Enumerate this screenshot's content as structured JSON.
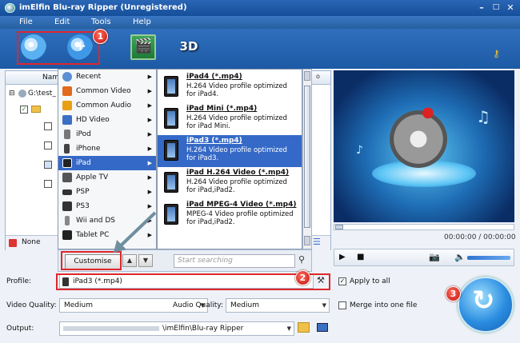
{
  "window": {
    "title": "imElfin Blu-ray Ripper (Unregistered)"
  },
  "menubar": {
    "items": [
      "File",
      "Edit",
      "Tools",
      "Help"
    ]
  },
  "filelist": {
    "header_name": "Name",
    "path": "G:\\test_",
    "subtitle_value": "None"
  },
  "categories": [
    {
      "label": "Recent",
      "icon": "clock-icon",
      "color": "#5b8fd6"
    },
    {
      "label": "Common Video",
      "icon": "film-icon",
      "color": "#e06a1e"
    },
    {
      "label": "Common Audio",
      "icon": "audio-icon",
      "color": "#e8a012"
    },
    {
      "label": "HD Video",
      "icon": "hd-icon",
      "color": "#3a6fc4"
    },
    {
      "label": "iPod",
      "icon": "ipod-icon",
      "color": "#777777"
    },
    {
      "label": "iPhone",
      "icon": "iphone-icon",
      "color": "#444444"
    },
    {
      "label": "iPad",
      "icon": "ipad-icon",
      "color": "#333333"
    },
    {
      "label": "Apple TV",
      "icon": "appletv-icon",
      "color": "#555555"
    },
    {
      "label": "PSP",
      "icon": "psp-icon",
      "color": "#333333"
    },
    {
      "label": "PS3",
      "icon": "ps3-icon",
      "color": "#333333"
    },
    {
      "label": "Wii and DS",
      "icon": "wii-icon",
      "color": "#888888"
    },
    {
      "label": "Tablet PC",
      "icon": "tablet-icon",
      "color": "#222222"
    }
  ],
  "selected_category": "iPad",
  "profiles": [
    {
      "title": "iPad4 (*.mp4)",
      "desc": "H.264 Video profile optimized for iPad4."
    },
    {
      "title": "iPad Mini (*.mp4)",
      "desc": "H.264 Video profile optimized for iPad Mini."
    },
    {
      "title": "iPad3 (*.mp4)",
      "desc": "H.264 Video profile optimized for iPad3."
    },
    {
      "title": "iPad H.264 Video (*.mp4)",
      "desc": "H.264 Video profile optimized for iPad,iPad2."
    },
    {
      "title": "iPad MPEG-4 Video (*.mp4)",
      "desc": "MPEG-4 Video profile optimized for iPad,iPad2."
    }
  ],
  "selected_profile": "iPad3 (*.mp4)",
  "bottom": {
    "customise_label": "Customise",
    "search_placeholder": "Start searching"
  },
  "player": {
    "time": "00:00:00 / 00:00:00"
  },
  "settings": {
    "profile_label": "Profile:",
    "profile_value": "iPad3 (*.mp4)",
    "apply_all_label": "Apply to all",
    "video_quality_label": "Video Quality:",
    "video_quality_value": "Medium",
    "audio_quality_label": "Audio Quality:",
    "audio_quality_value": "Medium",
    "merge_label": "Merge into one file",
    "output_label": "Output:",
    "output_value": "\\imElfin\\Blu-ray Ripper"
  },
  "callouts": [
    "1",
    "2",
    "3"
  ],
  "colors": {
    "accent": "#3569c7",
    "callout_red": "#e0262b",
    "toolbar": "#1d5aa5"
  }
}
